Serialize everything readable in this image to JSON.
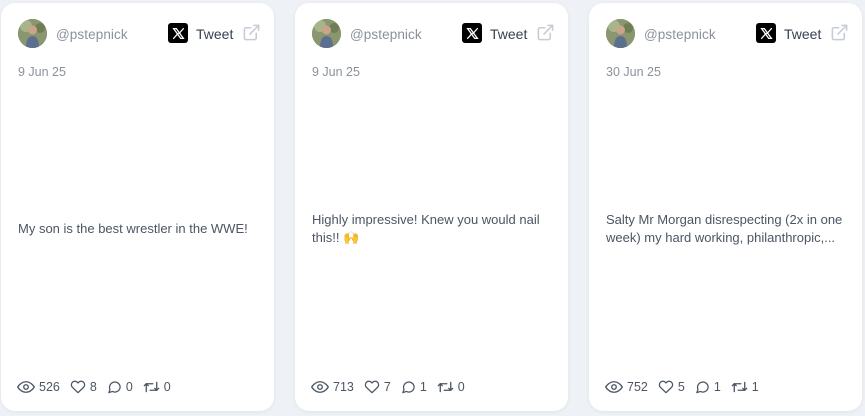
{
  "cards": [
    {
      "handle": "@pstepnick",
      "tweet_label": "Tweet",
      "date": "9 Jun 25",
      "text": "My son is the best wrestler in the WWE!",
      "views": "526",
      "likes": "8",
      "replies": "0",
      "retweets": "0"
    },
    {
      "handle": "@pstepnick",
      "tweet_label": "Tweet",
      "date": "9 Jun 25",
      "text": "Highly impressive! Knew you would nail this!! 🙌",
      "views": "713",
      "likes": "7",
      "replies": "1",
      "retweets": "0"
    },
    {
      "handle": "@pstepnick",
      "tweet_label": "Tweet",
      "date": "30 Jun 25",
      "text": "Salty Mr Morgan disrespecting (2x in one week) my hard working, philanthropic,...",
      "views": "752",
      "likes": "5",
      "replies": "1",
      "retweets": "1"
    }
  ],
  "colors": {
    "page_background": "#eef1f5",
    "card_background": "#ffffff",
    "muted_text": "#8b919c",
    "x_logo": "#000000"
  },
  "icons": [
    "avatar",
    "x-logo-icon",
    "external-link-icon",
    "eye-icon",
    "heart-icon",
    "comment-icon",
    "retweet-icon"
  ]
}
